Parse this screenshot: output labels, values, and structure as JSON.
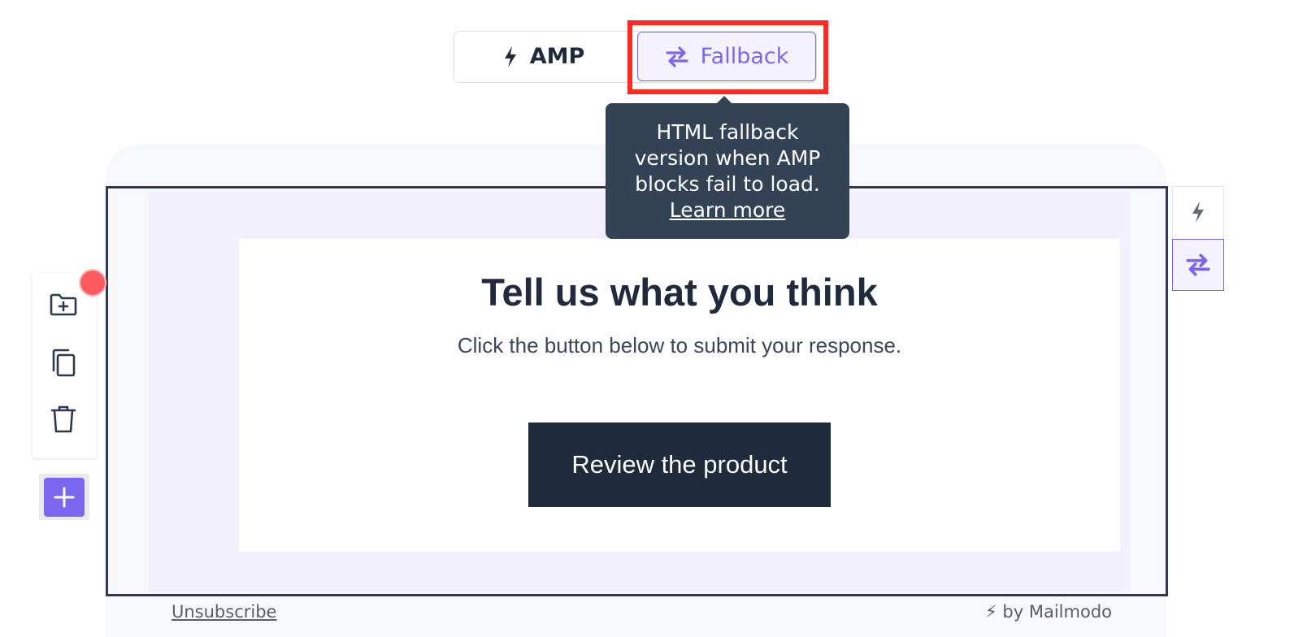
{
  "toggle": {
    "amp_label": "AMP",
    "fallback_label": "Fallback",
    "selected": "Fallback"
  },
  "tooltip": {
    "text": "HTML fallback version when AMP blocks fail to load.",
    "link": "Learn more"
  },
  "card": {
    "title": "Tell us what you think",
    "subtitle": "Click the button below to submit your response.",
    "button_label": "Review the product"
  },
  "footer": {
    "unsubscribe": "Unsubscribe",
    "branding": "⚡ by Mailmodo"
  },
  "left_toolbar": {
    "tools": [
      "folder-plus-icon",
      "copy-icon",
      "trash-icon"
    ],
    "add_icon": "plus-icon"
  },
  "colors": {
    "accent": "#7b66f0",
    "dark": "#1f2a3c",
    "highlight": "#ff2a1f",
    "tooltip_bg": "#344256",
    "notification_dot": "#ff5b60"
  }
}
